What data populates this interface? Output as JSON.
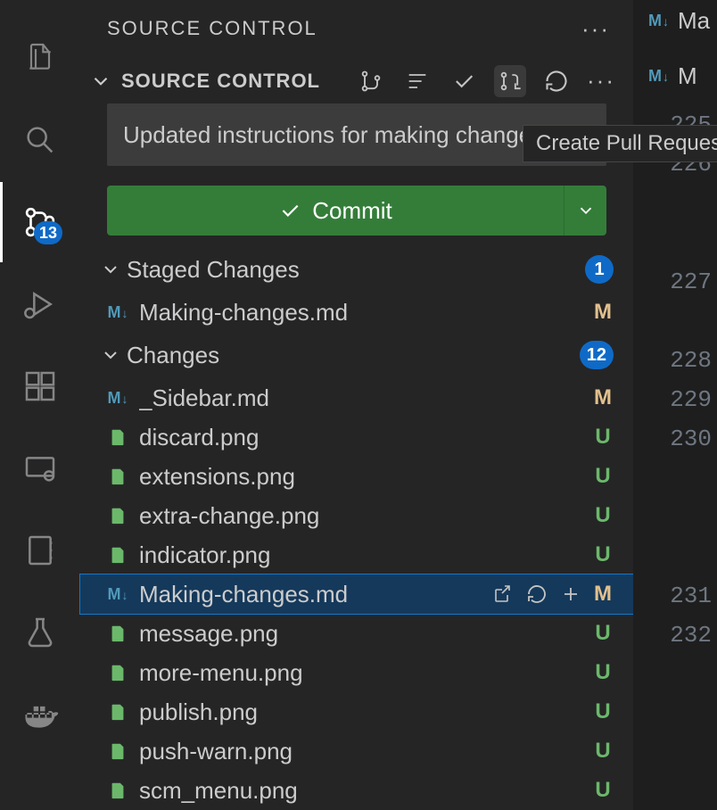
{
  "activity": {
    "scm_badge": "13"
  },
  "sidebar": {
    "title": "SOURCE CONTROL",
    "section": "SOURCE CONTROL"
  },
  "commit": {
    "message": "Updated instructions for making changes",
    "button": "Commit"
  },
  "groups": {
    "staged": {
      "label": "Staged Changes",
      "count": "1"
    },
    "changes": {
      "label": "Changes",
      "count": "12"
    }
  },
  "staged_files": [
    {
      "name": "Making-changes.md",
      "status": "M",
      "type": "md"
    }
  ],
  "changed_files": [
    {
      "name": "_Sidebar.md",
      "status": "M",
      "type": "md"
    },
    {
      "name": "discard.png",
      "status": "U",
      "type": "img"
    },
    {
      "name": "extensions.png",
      "status": "U",
      "type": "img"
    },
    {
      "name": "extra-change.png",
      "status": "U",
      "type": "img"
    },
    {
      "name": "indicator.png",
      "status": "U",
      "type": "img"
    },
    {
      "name": "Making-changes.md",
      "status": "M",
      "type": "md",
      "selected": true
    },
    {
      "name": "message.png",
      "status": "U",
      "type": "img"
    },
    {
      "name": "more-menu.png",
      "status": "U",
      "type": "img"
    },
    {
      "name": "publish.png",
      "status": "U",
      "type": "img"
    },
    {
      "name": "push-warn.png",
      "status": "U",
      "type": "img"
    },
    {
      "name": "scm_menu.png",
      "status": "U",
      "type": "img"
    }
  ],
  "tooltip": "Create Pull Request",
  "editor": {
    "tab_label": "Ma",
    "tab2_label": "M",
    "line_numbers": [
      "225",
      "226",
      "",
      "",
      "227",
      "",
      "228",
      "229",
      "230",
      "",
      "",
      "",
      "231",
      "232"
    ]
  }
}
